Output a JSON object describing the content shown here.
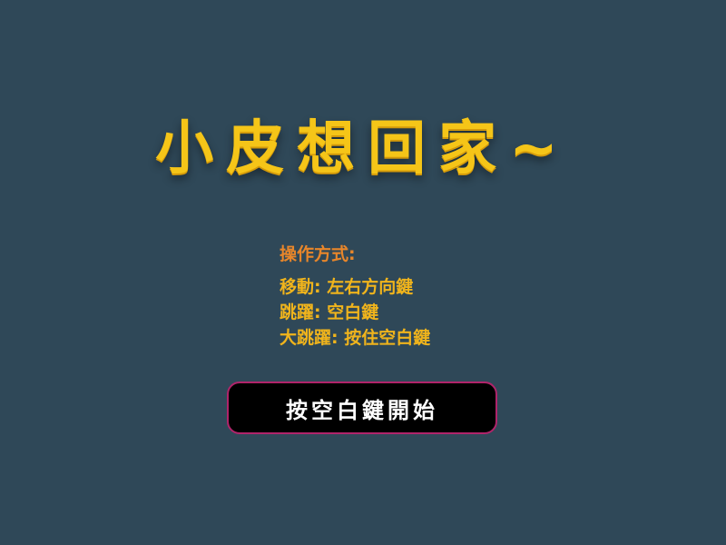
{
  "title": "小皮想回家~",
  "instructions": {
    "heading": "操作方式:",
    "rows": [
      "移動: 左右方向鍵",
      "跳躍: 空白鍵",
      "大跳躍: 按住空白鍵"
    ]
  },
  "start_button": {
    "label": "按空白鍵開始"
  },
  "colors": {
    "background": "#2f4858",
    "title": "#f5c518",
    "heading": "#e8862a",
    "instruction_text": "#f0b41c",
    "button_bg": "#000000",
    "button_border": "#b0246a",
    "button_text": "#ffffff"
  }
}
